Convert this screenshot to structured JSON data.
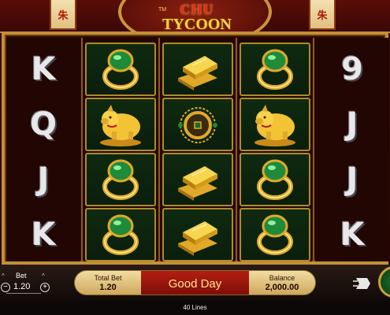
{
  "header": {
    "logo_top": "CHU",
    "logo_bottom": "TYCOON",
    "logo_tm": "TM",
    "lantern_glyph": "朱"
  },
  "reels": [
    [
      "K",
      "Q",
      "J",
      "K"
    ],
    [
      "jade-ring",
      "gold-pig",
      "jade-ring",
      "jade-ring"
    ],
    [
      "gold-bars",
      "coin-pendant",
      "gold-bars",
      "gold-bars"
    ],
    [
      "jade-ring",
      "gold-pig",
      "jade-ring",
      "jade-ring"
    ],
    [
      "9",
      "J",
      "J",
      "K"
    ]
  ],
  "controls": {
    "bet_label": "Bet",
    "bet_value": "1.20",
    "total_bet_label": "Total Bet",
    "total_bet_value": "1.20",
    "message": "Good Day",
    "balance_label": "Balance",
    "balance_value": "2,000.00",
    "minus": "−",
    "plus": "+",
    "chevron": "^"
  },
  "footer": {
    "lines_text": "40 Lines"
  },
  "colors": {
    "frame_gold": "#c29035",
    "message_red": "#b41e12",
    "pill_cream": "#f1dca1"
  }
}
